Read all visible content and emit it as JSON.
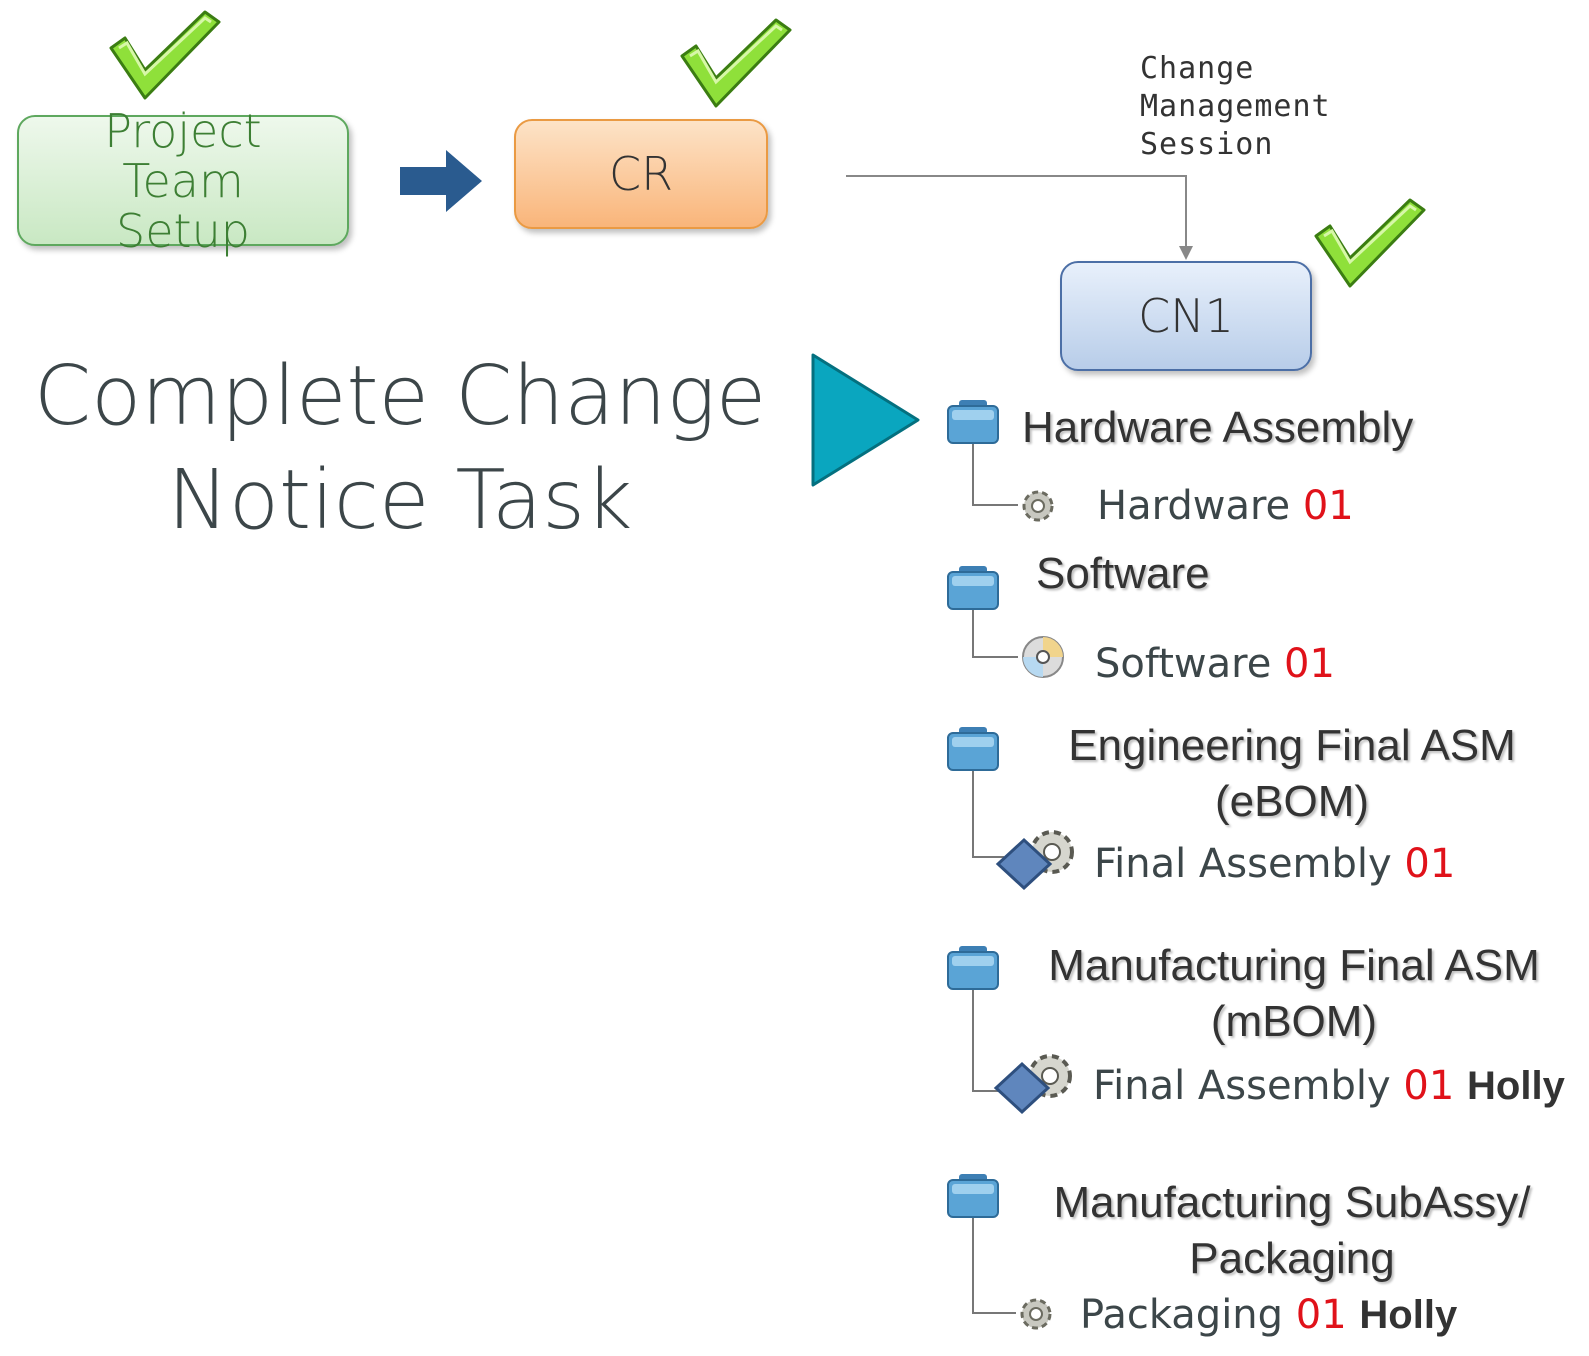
{
  "flow": {
    "setup_label": "Project Team Setup",
    "cr_label": "CR",
    "cn1_label": "CN1",
    "session_label": "Change Management Session"
  },
  "task_title": "Complete Change Notice Task",
  "tree": [
    {
      "group": "Hardware Assembly",
      "item_name": "Hardware",
      "item_rev": "01",
      "item_owner": "",
      "icon": "gear-icon"
    },
    {
      "group": "Software",
      "item_name": "Software",
      "item_rev": "01",
      "item_owner": "",
      "icon": "disc-icon"
    },
    {
      "group": "Engineering Final ASM (eBOM)",
      "item_name": "Final Assembly",
      "item_rev": "01",
      "item_owner": "",
      "icon": "assembly-icon"
    },
    {
      "group": "Manufacturing Final ASM (mBOM)",
      "item_name": "Final Assembly",
      "item_rev": "01",
      "item_owner": "Holly",
      "icon": "assembly-icon"
    },
    {
      "group": "Manufacturing SubAssy/ Packaging",
      "item_name": "Packaging",
      "item_rev": "01",
      "item_owner": "Holly",
      "icon": "gear-icon"
    }
  ],
  "colors": {
    "check": "#7ed321",
    "arrow_blue": "#2a5b8f",
    "play_teal": "#0aa6bf",
    "revision_red": "#e0121a"
  }
}
